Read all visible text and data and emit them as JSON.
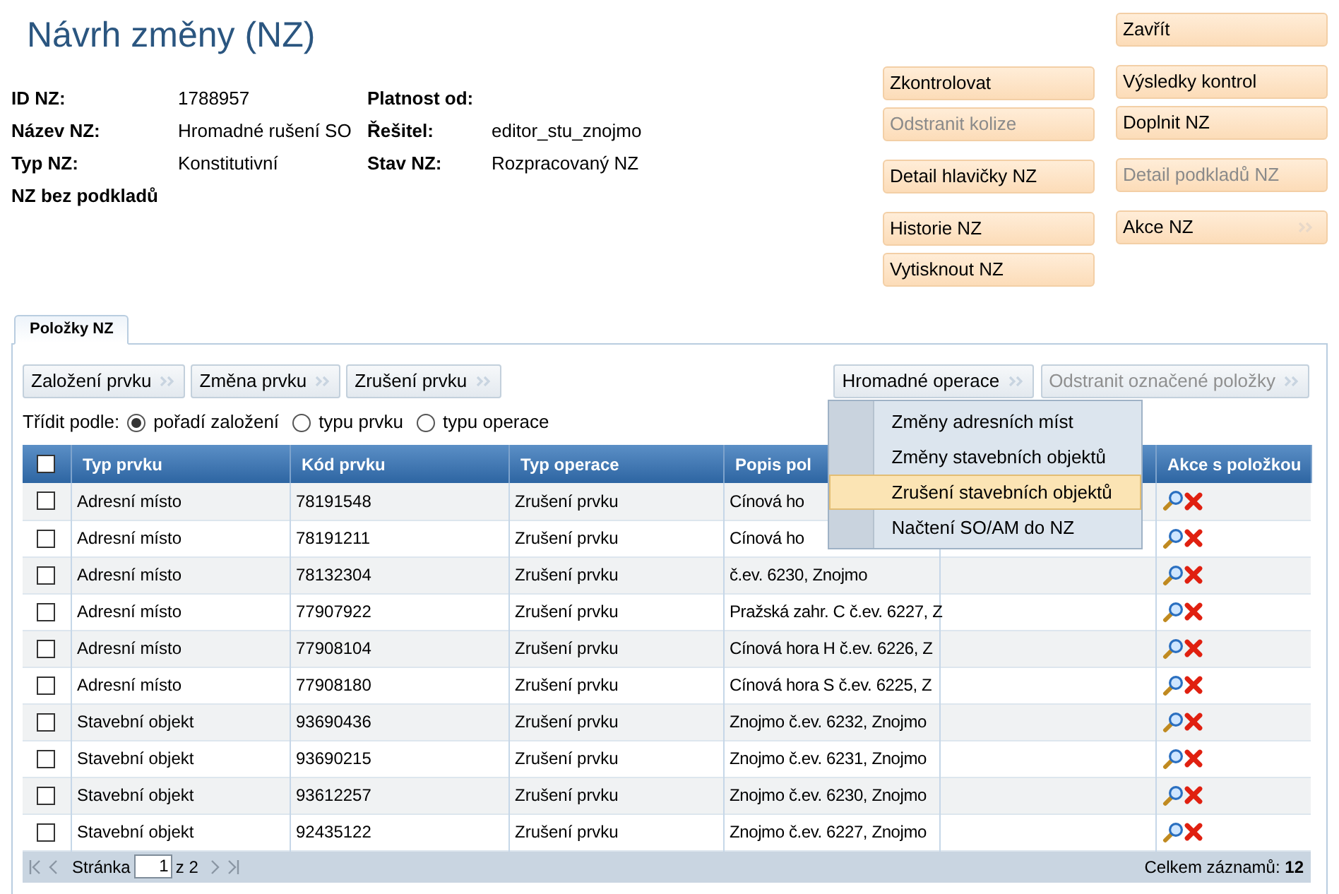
{
  "title": "Návrh změny (NZ)",
  "info": [
    {
      "label": "ID NZ:",
      "value": "1788957",
      "label2": "Platnost od:"
    },
    {
      "label": "Název NZ:",
      "value": "Hromadné rušení SO",
      "label2": "Řešitel:",
      "value2": "editor_stu_znojmo"
    },
    {
      "label": "Typ NZ:",
      "value": "Konstitutivní",
      "label2": "Stav NZ:",
      "value2": "Rozpracovaný NZ"
    }
  ],
  "note": "NZ bez podkladů",
  "button_columns": [
    {
      "groups": [
        [
          {
            "label": "Zkontrolovat",
            "disabled": false,
            "kind": "plain"
          },
          {
            "label": "Odstranit kolize",
            "disabled": true,
            "kind": "plain"
          }
        ],
        [
          {
            "label": "Detail hlavičky NZ",
            "disabled": false,
            "kind": "plain"
          }
        ],
        [
          {
            "label": "Historie NZ",
            "disabled": false,
            "kind": "plain"
          },
          {
            "label": "Vytisknout NZ",
            "disabled": false,
            "kind": "plain"
          }
        ]
      ]
    },
    {
      "groups": [
        [
          {
            "label": "Zavřít",
            "disabled": false,
            "kind": "plain"
          }
        ],
        [
          {
            "label": "Výsledky kontrol",
            "disabled": false,
            "kind": "plain"
          },
          {
            "label": "Doplnit NZ",
            "disabled": false,
            "kind": "plain"
          }
        ],
        [
          {
            "label": "Detail podkladů NZ",
            "disabled": true,
            "kind": "plain"
          }
        ],
        [
          {
            "label": "Akce NZ",
            "disabled": false,
            "kind": "menu"
          }
        ]
      ]
    }
  ],
  "tabs": [
    {
      "label": "Položky NZ",
      "selected": true
    }
  ],
  "toolbar_left": [
    {
      "label": "Založení prvku",
      "disabled": false
    },
    {
      "label": "Změna prvku",
      "disabled": false
    },
    {
      "label": "Zrušení prvku",
      "disabled": false
    }
  ],
  "toolbar_right": [
    {
      "label": "Hromadné operace",
      "disabled": false
    },
    {
      "label": "Odstranit označené položky",
      "disabled": true
    }
  ],
  "sort": {
    "label": "Třídit podle:",
    "options": [
      {
        "label": "pořadí založení",
        "selected": true
      },
      {
        "label": "typu prvku",
        "selected": false
      },
      {
        "label": "typu operace",
        "selected": false
      }
    ]
  },
  "menu": {
    "items": [
      {
        "label": "Změny adresních míst",
        "selected": false
      },
      {
        "label": "Změny stavebních objektů",
        "selected": false
      },
      {
        "label": "Zrušení stavebních objektů",
        "selected": true
      },
      {
        "label": "Načtení SO/AM do NZ",
        "selected": false
      }
    ]
  },
  "table": {
    "select_all": {
      "checked": false
    },
    "columns": [
      "Typ prvku",
      "Kód prvku",
      "Typ operace",
      "Popis pol",
      "",
      "Akce s položkou"
    ],
    "rows": [
      {
        "checked": false,
        "type": "Adresní místo",
        "code": "78191548",
        "operation": "Zrušení prvku",
        "description": "Cínová ho"
      },
      {
        "checked": false,
        "type": "Adresní místo",
        "code": "78191211",
        "operation": "Zrušení prvku",
        "description": "Cínová ho"
      },
      {
        "checked": false,
        "type": "Adresní místo",
        "code": "78132304",
        "operation": "Zrušení prvku",
        "description": "č.ev. 6230, Znojmo"
      },
      {
        "checked": false,
        "type": "Adresní místo",
        "code": "77907922",
        "operation": "Zrušení prvku",
        "description": "Pražská zahr. C č.ev. 6227, Z"
      },
      {
        "checked": false,
        "type": "Adresní místo",
        "code": "77908104",
        "operation": "Zrušení prvku",
        "description": "Cínová hora H č.ev. 6226, Z"
      },
      {
        "checked": false,
        "type": "Adresní místo",
        "code": "77908180",
        "operation": "Zrušení prvku",
        "description": "Cínová hora S č.ev. 6225, Z"
      },
      {
        "checked": false,
        "type": "Stavební objekt",
        "code": "93690436",
        "operation": "Zrušení prvku",
        "description": "Znojmo č.ev. 6232, Znojmo"
      },
      {
        "checked": false,
        "type": "Stavební objekt",
        "code": "93690215",
        "operation": "Zrušení prvku",
        "description": "Znojmo č.ev. 6231, Znojmo"
      },
      {
        "checked": false,
        "type": "Stavební objekt",
        "code": "93612257",
        "operation": "Zrušení prvku",
        "description": "Znojmo č.ev. 6230, Znojmo"
      },
      {
        "checked": false,
        "type": "Stavební objekt",
        "code": "92435122",
        "operation": "Zrušení prvku",
        "description": "Znojmo č.ev. 6227, Znojmo"
      }
    ]
  },
  "pager": {
    "page_label": "Stránka",
    "page": "1",
    "of": "z 2",
    "total": "Celkem záznamů: **12**"
  }
}
